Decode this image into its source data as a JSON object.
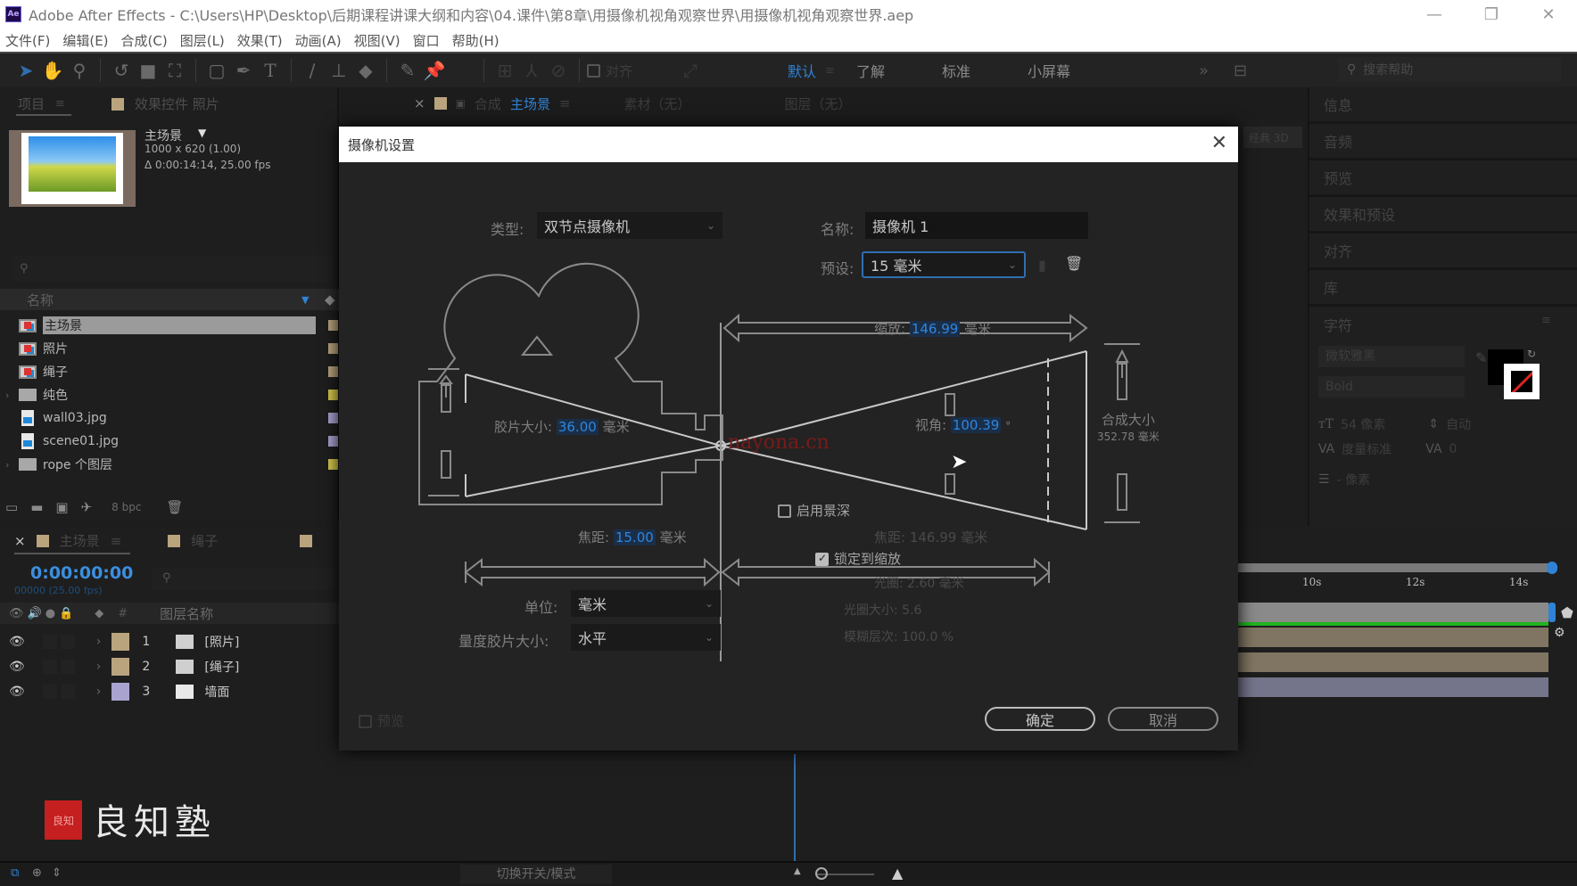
{
  "window": {
    "app_name": "Adobe After Effects",
    "title": "Adobe After Effects - C:\\Users\\HP\\Desktop\\后期课程讲课大纲和内容\\04.课件\\第8章\\用摄像机视角观察世界\\用摄像机视角观察世界.aep",
    "controls": {
      "minimize": "—",
      "restore": "❐",
      "close": "✕"
    }
  },
  "menubar": [
    "文件(F)",
    "编辑(E)",
    "合成(C)",
    "图层(L)",
    "效果(T)",
    "动画(A)",
    "视图(V)",
    "窗口",
    "帮助(H)"
  ],
  "toolbar": {
    "tools": [
      "selection",
      "hand",
      "zoom",
      "rotate",
      "camera",
      "pan-behind",
      "rectangle",
      "pen",
      "type",
      "brush",
      "clone-stamp",
      "eraser",
      "roto-brush",
      "puppet-pin"
    ],
    "align_label": "对齐",
    "workspaces": [
      {
        "label": "默认",
        "active": true
      },
      {
        "label": "了解",
        "active": false
      },
      {
        "label": "标准",
        "active": false
      },
      {
        "label": "小屏幕",
        "active": false
      }
    ],
    "more": "»",
    "search_placeholder": "搜索帮助"
  },
  "project_panel": {
    "tab_project": "项目",
    "tab_effects": "效果控件 照片",
    "comp_name": "主场景",
    "comp_dims": "1000 x 620 (1.00)",
    "comp_duration": "Δ 0:00:14:14, 25.00 fps",
    "column_name": "名称",
    "items": [
      {
        "name": "主场景",
        "type": "comp",
        "color": "#b9a47e",
        "selected": true,
        "expandable": false
      },
      {
        "name": "照片",
        "type": "comp",
        "color": "#b9a47e",
        "selected": false,
        "expandable": false
      },
      {
        "name": "绳子",
        "type": "comp",
        "color": "#b9a47e",
        "selected": false,
        "expandable": false
      },
      {
        "name": "纯色",
        "type": "folder",
        "color": "#d8c94a",
        "selected": false,
        "expandable": true
      },
      {
        "name": "wall03.jpg",
        "type": "image",
        "color": "#a9a3d0",
        "selected": false,
        "expandable": false
      },
      {
        "name": "scene01.jpg",
        "type": "image",
        "color": "#a9a3d0",
        "selected": false,
        "expandable": false
      },
      {
        "name": "rope 个图层",
        "type": "folder",
        "color": "#d8c94a",
        "selected": false,
        "expandable": true
      }
    ],
    "bpc": "8 bpc"
  },
  "comp_tabs": {
    "close": "×",
    "lock": "🔒",
    "comp_prefix": "合成",
    "comp_name": "主场景",
    "footage": "素材（无）",
    "layer": "图层（无）"
  },
  "dialog": {
    "title": "摄像机设置",
    "type_label": "类型:",
    "type_value": "双节点摄像机",
    "name_label": "名称:",
    "name_value": "摄像机 1",
    "preset_label": "预设:",
    "preset_value": "15 毫米",
    "zoom_label": "缩放:",
    "zoom_value": "146.99",
    "film_size_label": "胶片大小:",
    "film_size_value": "36.00",
    "angle_label": "视角:",
    "angle_value": "100.39",
    "angle_unit": "°",
    "comp_size_label": "合成大小",
    "comp_size_value": "352.78 毫米",
    "focal_length_label": "焦距:",
    "focal_length_value": "15.00",
    "focus_distance_label": "焦距:",
    "focus_distance_value": "146.99 毫米",
    "unit_mm": "毫米",
    "enable_dof_label": "启用景深",
    "enable_dof_checked": false,
    "lock_to_zoom_label": "锁定到缩放",
    "lock_to_zoom_checked": true,
    "aperture_label": "光圈:",
    "aperture_value": "2.60 毫米",
    "fstop_label": "光圈大小:",
    "fstop_value": "5.6",
    "blur_level_label": "模糊层次:",
    "blur_level_value": "100.0 %",
    "units_label": "单位:",
    "units_value": "毫米",
    "measure_label": "量度胶片大小:",
    "measure_value": "水平",
    "preview_label": "预览",
    "preview_checked": false,
    "ok_label": "确定",
    "cancel_label": "取消",
    "watermark": "nayona.cn"
  },
  "right_panel": {
    "items": [
      "信息",
      "音频",
      "预览",
      "效果和预设",
      "对齐",
      "库"
    ],
    "character_title": "字符",
    "font_family": "微软雅黑",
    "font_style": "Bold",
    "font_size": "54 像素",
    "leading": "自动",
    "kerning": "度量标准",
    "tracking": "0",
    "stroke_width": "- 像素",
    "renderer_3d": "经典 3D"
  },
  "timeline": {
    "tab_main": "主场景",
    "tab_rope": "绳子",
    "timecode": "0:00:00:00",
    "frame_info": "00000 (25.00 fps)",
    "col_layer_name": "图层名称",
    "col_num": "#",
    "layers": [
      {
        "num": "1",
        "name": "[照片]",
        "type": "comp",
        "color": "#b9a47e"
      },
      {
        "num": "2",
        "name": "[绳子]",
        "type": "comp",
        "color": "#b9a47e"
      },
      {
        "num": "3",
        "name": "墙面",
        "type": "image",
        "color": "#a9a3d0"
      }
    ],
    "ruler_labels": [
      "10s",
      "12s",
      "14s"
    ],
    "toggle_label": "切换开关/模式",
    "bar_colors": [
      "#8a8a8a",
      "#7f7562",
      "#7f7562",
      "#74748a"
    ]
  },
  "branding": {
    "seal": "良知",
    "name": "良知塾"
  }
}
